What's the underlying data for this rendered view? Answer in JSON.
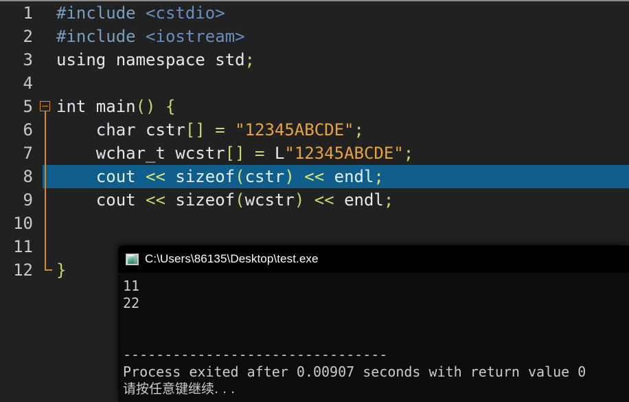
{
  "editor": {
    "name": "code-editor",
    "background": "#212121",
    "selection_color": "#0f5e8c",
    "fold_marker_color": "#e08a1e",
    "gutter_number_color": "#c9c9c9",
    "lines": [
      {
        "num": "1",
        "selected": false,
        "fold": "none",
        "tokens": [
          {
            "t": "#include ",
            "c": "t-pre"
          },
          {
            "t": "<cstdio>",
            "c": "t-hdr"
          }
        ]
      },
      {
        "num": "2",
        "selected": false,
        "fold": "none",
        "tokens": [
          {
            "t": "#include ",
            "c": "t-pre"
          },
          {
            "t": "<iostream>",
            "c": "t-hdr"
          }
        ]
      },
      {
        "num": "3",
        "selected": false,
        "fold": "none",
        "tokens": [
          {
            "t": "using namespace std",
            "c": "t-plain"
          },
          {
            "t": ";",
            "c": "t-punc"
          }
        ]
      },
      {
        "num": "4",
        "selected": false,
        "fold": "none",
        "tokens": []
      },
      {
        "num": "5",
        "selected": false,
        "fold": "start",
        "tokens": [
          {
            "t": "int",
            "c": "t-type"
          },
          {
            "t": " main",
            "c": "t-id"
          },
          {
            "t": "()",
            "c": "t-punc"
          },
          {
            "t": " ",
            "c": "t-plain"
          },
          {
            "t": "{",
            "c": "t-brace"
          }
        ]
      },
      {
        "num": "6",
        "selected": false,
        "fold": "mid",
        "tokens": [
          {
            "t": "    ",
            "c": "t-plain"
          },
          {
            "t": "char",
            "c": "t-type"
          },
          {
            "t": " cstr",
            "c": "t-id"
          },
          {
            "t": "[]",
            "c": "t-punc"
          },
          {
            "t": " ",
            "c": "t-plain"
          },
          {
            "t": "=",
            "c": "t-op"
          },
          {
            "t": " ",
            "c": "t-plain"
          },
          {
            "t": "\"12345ABCDE\"",
            "c": "t-str"
          },
          {
            "t": ";",
            "c": "t-punc"
          }
        ]
      },
      {
        "num": "7",
        "selected": false,
        "fold": "mid",
        "tokens": [
          {
            "t": "    ",
            "c": "t-plain"
          },
          {
            "t": "wchar_t",
            "c": "t-type"
          },
          {
            "t": " wcstr",
            "c": "t-id"
          },
          {
            "t": "[]",
            "c": "t-punc"
          },
          {
            "t": " ",
            "c": "t-plain"
          },
          {
            "t": "=",
            "c": "t-op"
          },
          {
            "t": " ",
            "c": "t-plain"
          },
          {
            "t": "L",
            "c": "t-plain"
          },
          {
            "t": "\"12345ABCDE\"",
            "c": "t-str"
          },
          {
            "t": ";",
            "c": "t-punc"
          }
        ]
      },
      {
        "num": "8",
        "selected": true,
        "fold": "mid",
        "tokens": [
          {
            "t": "    ",
            "c": "t-sel"
          },
          {
            "t": "cout",
            "c": "t-sel"
          },
          {
            "t": " ",
            "c": "t-sel"
          },
          {
            "t": "<<",
            "c": "t-sel-op"
          },
          {
            "t": " ",
            "c": "t-sel"
          },
          {
            "t": "sizeof",
            "c": "t-sel"
          },
          {
            "t": "(",
            "c": "t-sel-op"
          },
          {
            "t": "cstr",
            "c": "t-sel"
          },
          {
            "t": ")",
            "c": "t-sel-op"
          },
          {
            "t": " ",
            "c": "t-sel"
          },
          {
            "t": "<<",
            "c": "t-sel-op"
          },
          {
            "t": " ",
            "c": "t-sel"
          },
          {
            "t": "endl",
            "c": "t-sel"
          },
          {
            "t": ";",
            "c": "t-sel-op"
          }
        ]
      },
      {
        "num": "9",
        "selected": false,
        "fold": "mid",
        "tokens": [
          {
            "t": "    ",
            "c": "t-plain"
          },
          {
            "t": "cout",
            "c": "t-plain"
          },
          {
            "t": " ",
            "c": "t-plain"
          },
          {
            "t": "<<",
            "c": "t-op"
          },
          {
            "t": " ",
            "c": "t-plain"
          },
          {
            "t": "sizeof",
            "c": "t-plain"
          },
          {
            "t": "(",
            "c": "t-punc"
          },
          {
            "t": "wcstr",
            "c": "t-id"
          },
          {
            "t": ")",
            "c": "t-punc"
          },
          {
            "t": " ",
            "c": "t-plain"
          },
          {
            "t": "<<",
            "c": "t-op"
          },
          {
            "t": " ",
            "c": "t-plain"
          },
          {
            "t": "endl",
            "c": "t-plain"
          },
          {
            "t": ";",
            "c": "t-punc"
          }
        ]
      },
      {
        "num": "10",
        "selected": false,
        "fold": "mid",
        "tokens": []
      },
      {
        "num": "11",
        "selected": false,
        "fold": "mid",
        "tokens": []
      },
      {
        "num": "12",
        "selected": false,
        "fold": "end",
        "tokens": [
          {
            "t": "}",
            "c": "t-brace"
          }
        ]
      }
    ]
  },
  "console": {
    "title": "C:\\Users\\86135\\Desktop\\test.exe",
    "icon": "console-window-icon",
    "background": "#0c0c0c",
    "titlebar_background": "#000000",
    "text_color": "#cccccc",
    "output_lines": [
      {
        "text": "11",
        "kind": "plain"
      },
      {
        "text": "22",
        "kind": "plain"
      },
      {
        "text": "",
        "kind": "blank"
      },
      {
        "text": "",
        "kind": "blank"
      },
      {
        "text": "--------------------------------",
        "kind": "separator"
      },
      {
        "text": "Process exited after 0.00907 seconds with return value 0",
        "kind": "plain"
      },
      {
        "text": "请按任意键继续. . .",
        "kind": "cjk"
      }
    ]
  }
}
